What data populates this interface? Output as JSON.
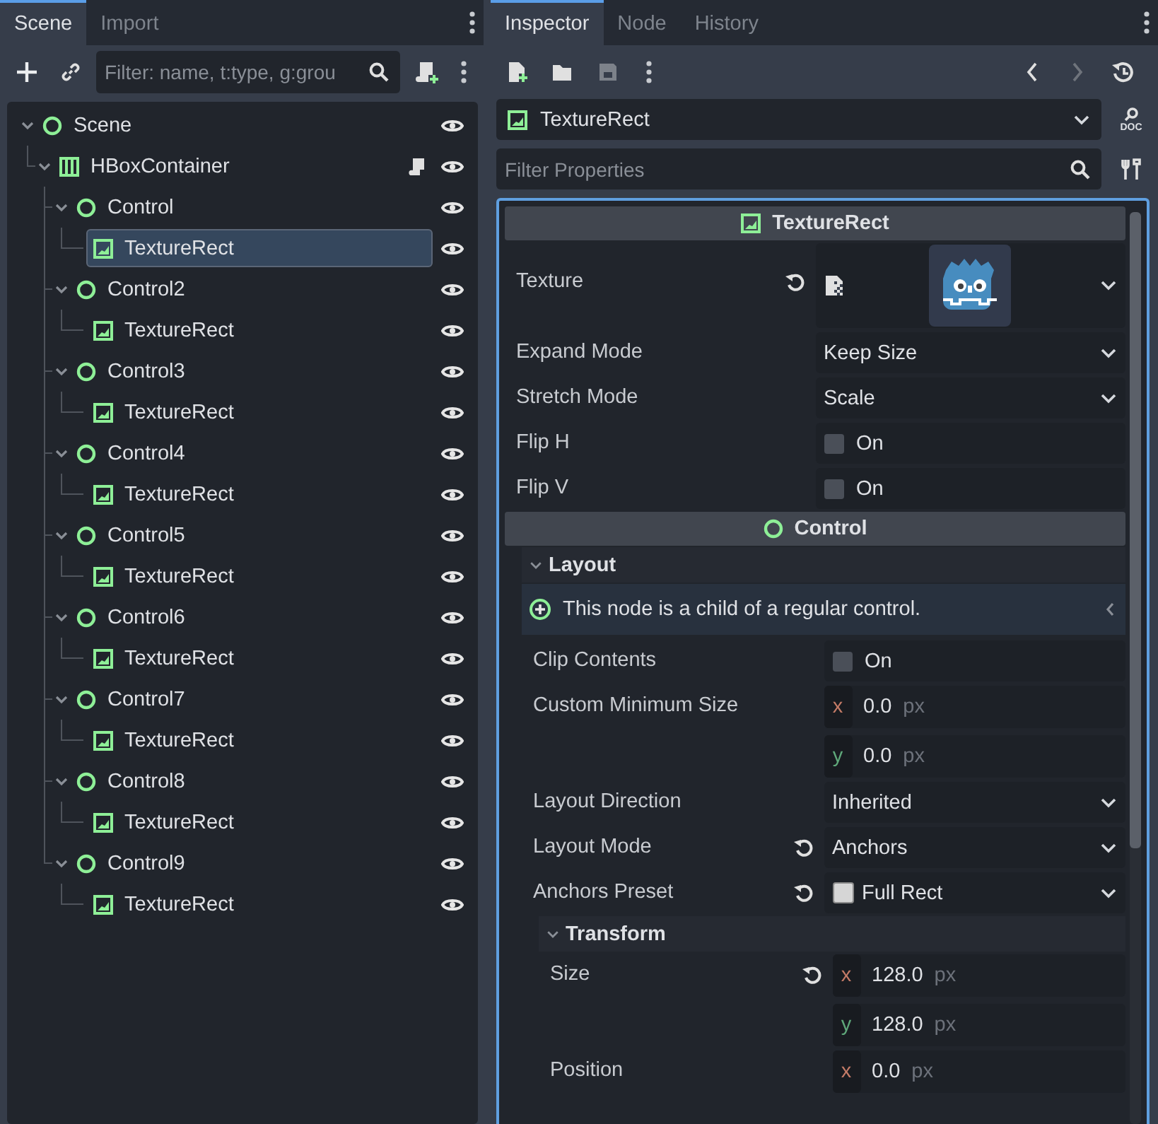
{
  "scene_panel": {
    "tabs": [
      {
        "label": "Scene",
        "selected": true
      },
      {
        "label": "Import",
        "selected": false
      }
    ],
    "filter": {
      "placeholder": "Filter: name, t:type, g:grou"
    },
    "tree": [
      {
        "name": "Scene",
        "kind": "node",
        "expanded": true,
        "selected": false,
        "visible": true,
        "has_script": false,
        "children": [
          {
            "name": "HBoxContainer",
            "kind": "hbox",
            "expanded": true,
            "selected": false,
            "visible": true,
            "has_script": true,
            "children": [
              {
                "name": "Control",
                "kind": "node",
                "expanded": true,
                "selected": false,
                "visible": true,
                "has_script": false,
                "children": [
                  {
                    "name": "TextureRect",
                    "kind": "texture",
                    "selected": true,
                    "visible": true,
                    "has_script": false
                  }
                ]
              },
              {
                "name": "Control2",
                "kind": "node",
                "expanded": true,
                "selected": false,
                "visible": true,
                "has_script": false,
                "children": [
                  {
                    "name": "TextureRect",
                    "kind": "texture",
                    "selected": false,
                    "visible": true,
                    "has_script": false
                  }
                ]
              },
              {
                "name": "Control3",
                "kind": "node",
                "expanded": true,
                "selected": false,
                "visible": true,
                "has_script": false,
                "children": [
                  {
                    "name": "TextureRect",
                    "kind": "texture",
                    "selected": false,
                    "visible": true,
                    "has_script": false
                  }
                ]
              },
              {
                "name": "Control4",
                "kind": "node",
                "expanded": true,
                "selected": false,
                "visible": true,
                "has_script": false,
                "children": [
                  {
                    "name": "TextureRect",
                    "kind": "texture",
                    "selected": false,
                    "visible": true,
                    "has_script": false
                  }
                ]
              },
              {
                "name": "Control5",
                "kind": "node",
                "expanded": true,
                "selected": false,
                "visible": true,
                "has_script": false,
                "children": [
                  {
                    "name": "TextureRect",
                    "kind": "texture",
                    "selected": false,
                    "visible": true,
                    "has_script": false
                  }
                ]
              },
              {
                "name": "Control6",
                "kind": "node",
                "expanded": true,
                "selected": false,
                "visible": true,
                "has_script": false,
                "children": [
                  {
                    "name": "TextureRect",
                    "kind": "texture",
                    "selected": false,
                    "visible": true,
                    "has_script": false
                  }
                ]
              },
              {
                "name": "Control7",
                "kind": "node",
                "expanded": true,
                "selected": false,
                "visible": true,
                "has_script": false,
                "children": [
                  {
                    "name": "TextureRect",
                    "kind": "texture",
                    "selected": false,
                    "visible": true,
                    "has_script": false
                  }
                ]
              },
              {
                "name": "Control8",
                "kind": "node",
                "expanded": true,
                "selected": false,
                "visible": true,
                "has_script": false,
                "children": [
                  {
                    "name": "TextureRect",
                    "kind": "texture",
                    "selected": false,
                    "visible": true,
                    "has_script": false
                  }
                ]
              },
              {
                "name": "Control9",
                "kind": "node",
                "expanded": true,
                "selected": false,
                "visible": true,
                "has_script": false,
                "children": [
                  {
                    "name": "TextureRect",
                    "kind": "texture",
                    "selected": false,
                    "visible": true,
                    "has_script": false
                  }
                ]
              }
            ]
          }
        ]
      }
    ]
  },
  "inspector": {
    "tabs": [
      {
        "label": "Inspector",
        "selected": true
      },
      {
        "label": "Node",
        "selected": false
      },
      {
        "label": "History",
        "selected": false
      }
    ],
    "node_selector": {
      "kind": "texture",
      "label": "TextureRect"
    },
    "doc_button": {
      "label": "DOC"
    },
    "filter": {
      "placeholder": "Filter Properties"
    },
    "sections": [
      {
        "title": "TextureRect",
        "kind": "texture",
        "items": [
          {
            "kind": "texture",
            "label": "Texture",
            "revertable": true
          },
          {
            "kind": "dropdown",
            "label": "Expand Mode",
            "value": "Keep Size",
            "revertable": false
          },
          {
            "kind": "dropdown",
            "label": "Stretch Mode",
            "value": "Scale",
            "revertable": false
          },
          {
            "kind": "checkbox",
            "label": "Flip H",
            "text": "On",
            "checked": false
          },
          {
            "kind": "checkbox",
            "label": "Flip V",
            "text": "On",
            "checked": false
          }
        ]
      },
      {
        "title": "Control",
        "kind": "node",
        "items": [
          {
            "kind": "group",
            "label": "Layout",
            "expanded": true,
            "children": [
              {
                "kind": "note",
                "text": "This node is a child of a regular control."
              },
              {
                "kind": "checkbox",
                "label": "Clip Contents",
                "text": "On",
                "checked": false
              },
              {
                "kind": "vector",
                "label": "Custom Minimum Size",
                "revertable": false,
                "components": [
                  {
                    "axis": "x",
                    "value": "0.0",
                    "unit": "px"
                  },
                  {
                    "axis": "y",
                    "value": "0.0",
                    "unit": "px"
                  }
                ]
              },
              {
                "kind": "dropdown",
                "label": "Layout Direction",
                "value": "Inherited",
                "revertable": false
              },
              {
                "kind": "dropdown",
                "label": "Layout Mode",
                "value": "Anchors",
                "revertable": true
              },
              {
                "kind": "preset",
                "label": "Anchors Preset",
                "value": "Full Rect",
                "revertable": true
              },
              {
                "kind": "group",
                "label": "Transform",
                "expanded": true,
                "children": [
                  {
                    "kind": "vector",
                    "label": "Size",
                    "revertable": true,
                    "components": [
                      {
                        "axis": "x",
                        "value": "128.0",
                        "unit": "px"
                      },
                      {
                        "axis": "y",
                        "value": "128.0",
                        "unit": "px"
                      }
                    ]
                  },
                  {
                    "kind": "vector",
                    "label": "Position",
                    "revertable": false,
                    "components": [
                      {
                        "axis": "x",
                        "value": "0.0",
                        "unit": "px"
                      }
                    ]
                  }
                ]
              }
            ]
          }
        ]
      }
    ]
  }
}
